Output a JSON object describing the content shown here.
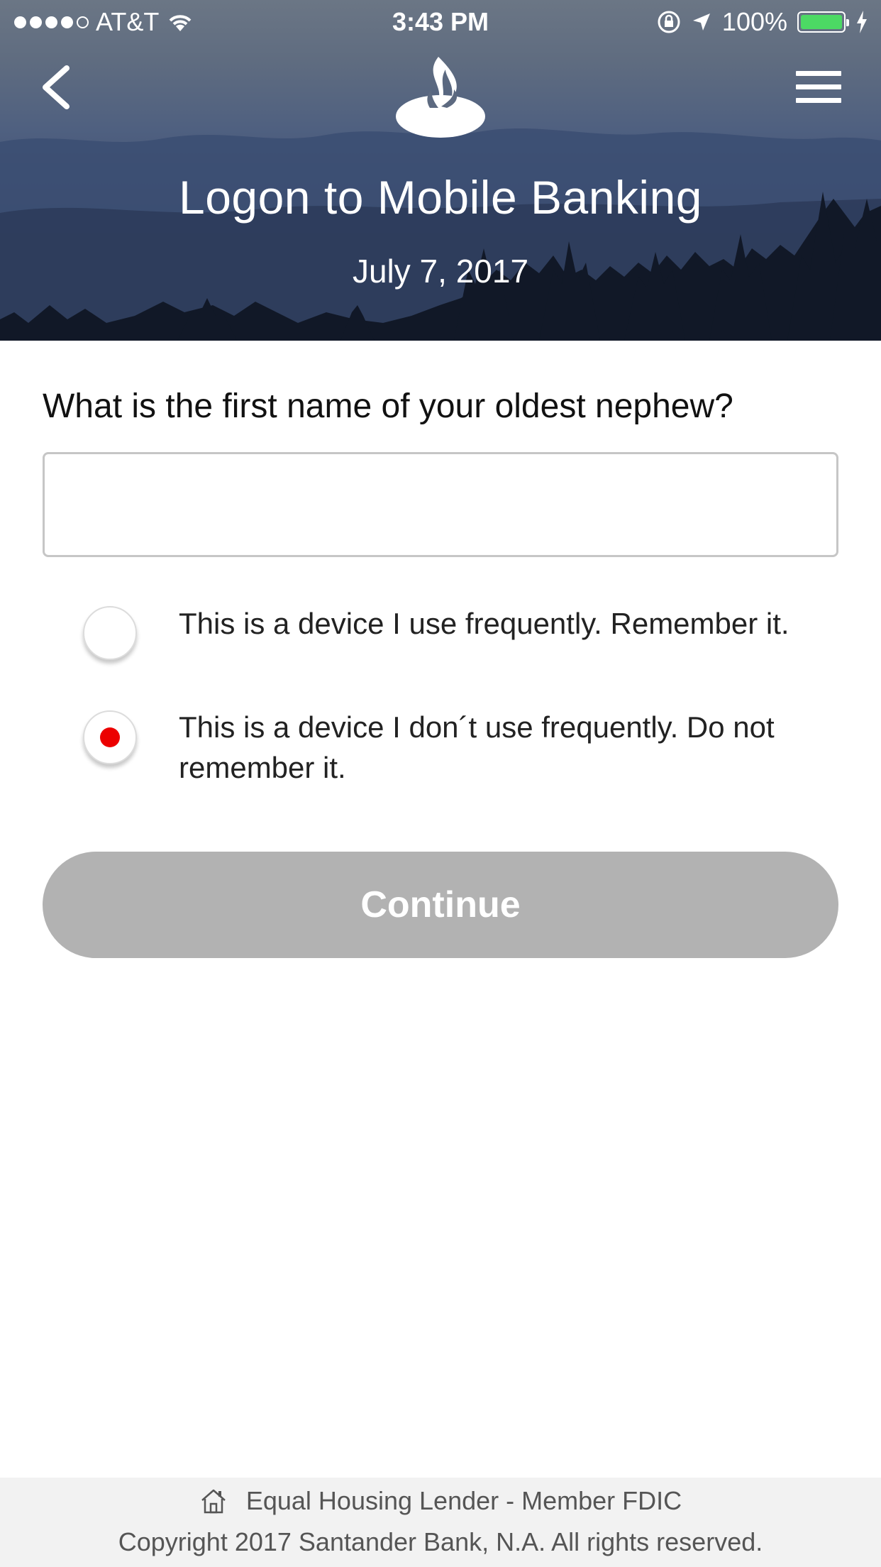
{
  "status_bar": {
    "carrier": "AT&T",
    "time": "3:43 PM",
    "battery": "100%",
    "signal_bars_filled": 4,
    "signal_bars_total": 5,
    "battery_level": 1.0
  },
  "header": {
    "title": "Logon to Mobile Banking",
    "date": "July 7, 2017",
    "back_icon": "chevron-left-icon",
    "menu_icon": "hamburger-menu-icon",
    "logo_icon": "santander-flame-logo"
  },
  "security_question": {
    "question": "What is the first name of your oldest nephew?",
    "answer_value": "",
    "answer_placeholder": ""
  },
  "device_options": [
    {
      "label": "This is a device I use frequently. Remember it.",
      "selected": false
    },
    {
      "label": "This is a device I don´t use frequently. Do not remember it.",
      "selected": true
    }
  ],
  "continue_button": {
    "label": "Continue",
    "enabled": false
  },
  "footer": {
    "housing": "Equal Housing Lender - Member FDIC",
    "copyright": "Copyright 2017 Santander Bank, N.A. All rights reserved.",
    "housing_icon": "house-icon"
  },
  "colors": {
    "accent_red": "#ec0000",
    "button_disabled": "#b2b2b2",
    "battery_green": "#4cd964",
    "footer_bg": "#f2f2f2"
  }
}
